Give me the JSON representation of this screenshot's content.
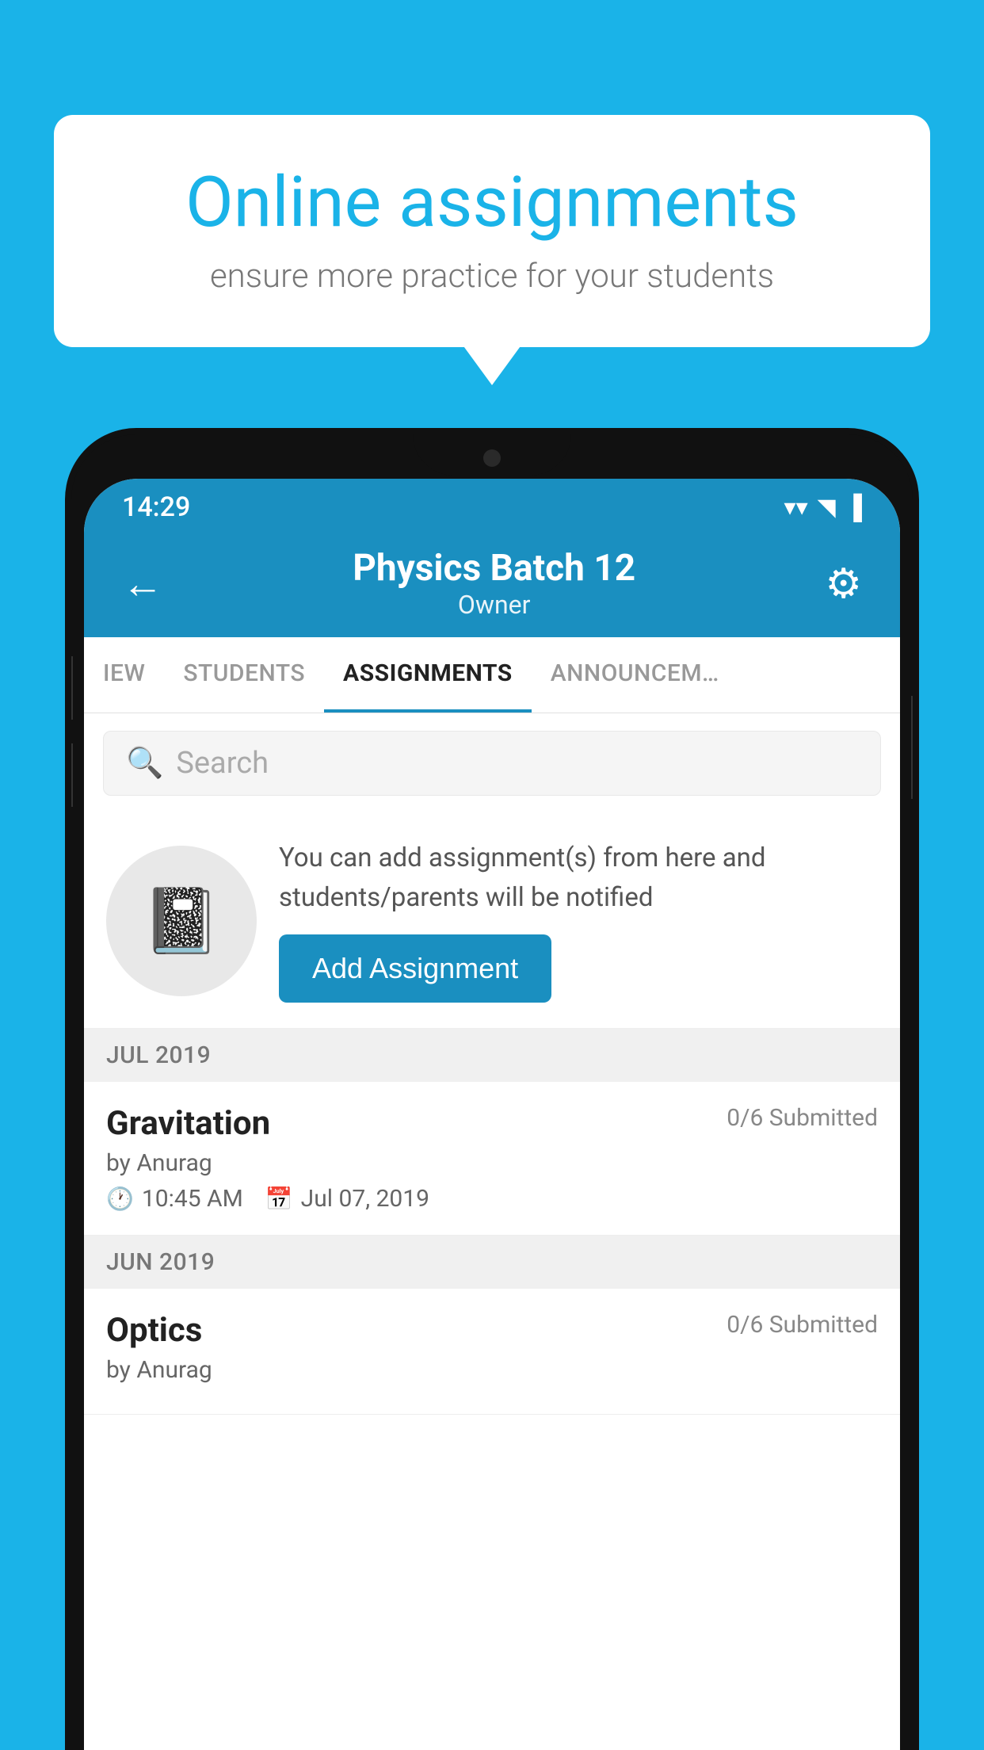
{
  "background_color": "#1ab3e8",
  "speech_bubble": {
    "title": "Online assignments",
    "subtitle": "ensure more practice for your students"
  },
  "phone": {
    "status_bar": {
      "time": "14:29",
      "wifi": "▼",
      "signal": "▲",
      "battery": "▐"
    },
    "header": {
      "title": "Physics Batch 12",
      "subtitle": "Owner",
      "back_label": "←",
      "settings_label": "⚙"
    },
    "tabs": [
      {
        "label": "IEW",
        "active": false
      },
      {
        "label": "STUDENTS",
        "active": false
      },
      {
        "label": "ASSIGNMENTS",
        "active": true
      },
      {
        "label": "ANNOUNCEM…",
        "active": false
      }
    ],
    "search": {
      "placeholder": "Search"
    },
    "promo": {
      "description": "You can add assignment(s) from here and students/parents will be notified",
      "button_label": "Add Assignment"
    },
    "assignments": [
      {
        "month_label": "JUL 2019",
        "items": [
          {
            "title": "Gravitation",
            "submitted": "0/6 Submitted",
            "author": "by Anurag",
            "time": "10:45 AM",
            "date": "Jul 07, 2019"
          }
        ]
      },
      {
        "month_label": "JUN 2019",
        "items": [
          {
            "title": "Optics",
            "submitted": "0/6 Submitted",
            "author": "by Anurag",
            "time": "",
            "date": ""
          }
        ]
      }
    ]
  }
}
